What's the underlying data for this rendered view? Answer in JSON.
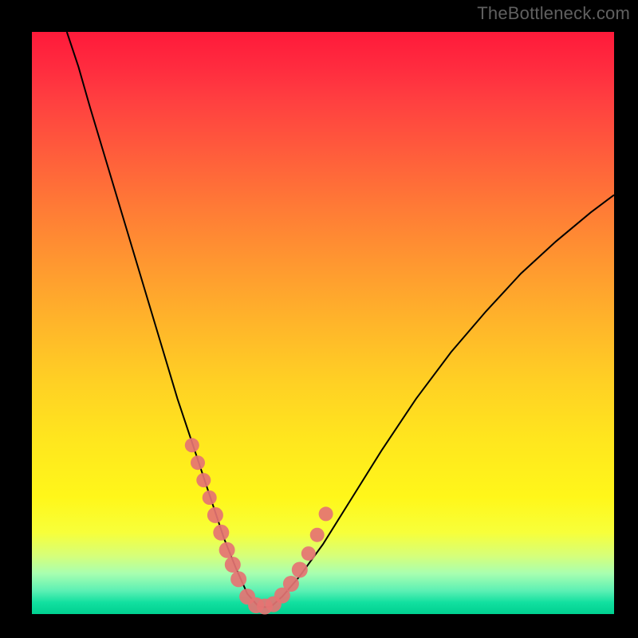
{
  "attribution": "TheBottleneck.com",
  "chart_data": {
    "type": "line",
    "title": "",
    "xlabel": "",
    "ylabel": "",
    "x_range": [
      0,
      1
    ],
    "y_range_pct": [
      0,
      100
    ],
    "series": [
      {
        "name": "bottleneck-curve",
        "note": "x is normalized horizontal position (0=left,1=right); y is bottleneck % (0=ideal at bottom, 100=worst at top). Curve minimum near x≈0.39.",
        "x": [
          0.06,
          0.08,
          0.1,
          0.13,
          0.16,
          0.19,
          0.22,
          0.25,
          0.28,
          0.31,
          0.33,
          0.35,
          0.37,
          0.39,
          0.41,
          0.43,
          0.46,
          0.5,
          0.55,
          0.6,
          0.66,
          0.72,
          0.78,
          0.84,
          0.9,
          0.96,
          1.0
        ],
        "y": [
          100.0,
          94.0,
          87.0,
          77.0,
          67.0,
          57.0,
          47.0,
          37.0,
          28.0,
          19.0,
          13.0,
          8.0,
          3.5,
          1.2,
          1.2,
          3.0,
          6.5,
          12.0,
          20.0,
          28.0,
          37.0,
          45.0,
          52.0,
          58.5,
          64.0,
          69.0,
          72.0
        ]
      }
    ],
    "markers": {
      "name": "highlight-dots",
      "note": "overlay dots along both branches near minimum",
      "x": [
        0.275,
        0.285,
        0.295,
        0.305,
        0.315,
        0.325,
        0.335,
        0.345,
        0.355,
        0.37,
        0.385,
        0.4,
        0.415,
        0.43,
        0.445,
        0.46,
        0.475,
        0.49,
        0.505
      ],
      "y": [
        29.0,
        26.0,
        23.0,
        20.0,
        17.0,
        14.0,
        11.0,
        8.5,
        6.0,
        3.0,
        1.5,
        1.3,
        1.7,
        3.2,
        5.2,
        7.6,
        10.4,
        13.6,
        17.2
      ]
    },
    "colors": {
      "curve": "#000000",
      "dot": "#e57373",
      "gradient_top": "#ff1a3a",
      "gradient_bottom": "#00d090"
    }
  }
}
